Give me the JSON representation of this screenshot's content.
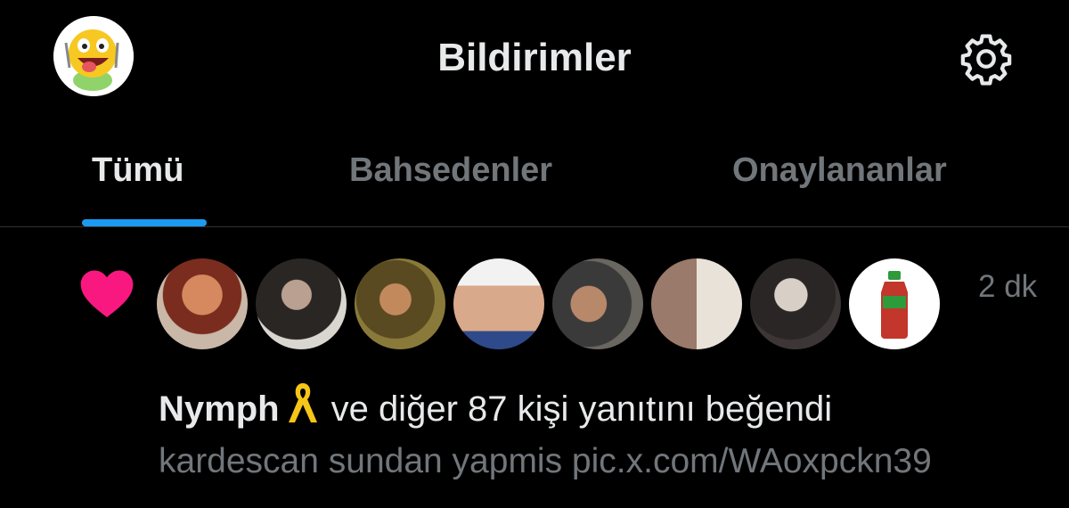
{
  "header": {
    "title": "Bildirimler",
    "avatar_icon": "laughing-emoji-avatar",
    "settings_icon": "gear-icon"
  },
  "tabs": [
    {
      "label": "Tümü",
      "active": true
    },
    {
      "label": "Bahsedenler",
      "active": false
    },
    {
      "label": "Onaylananlar",
      "active": false
    }
  ],
  "notification": {
    "icon": "heart-icon",
    "time": "2 dk",
    "actor_name": "Nymph",
    "actor_badge": "yellow-ribbon-emoji",
    "action_text": "ve diğer 87 kişi yanıtını beğendi",
    "preview_text": "kardescan sundan yapmis pic.x.com/WAoxpckn39",
    "avatar_count": 8
  },
  "colors": {
    "background": "#000000",
    "accent": "#1d9bf0",
    "heart": "#f91880",
    "ribbon": "#f5c518",
    "muted_text": "#71767b",
    "primary_text": "#e7e9ea"
  }
}
